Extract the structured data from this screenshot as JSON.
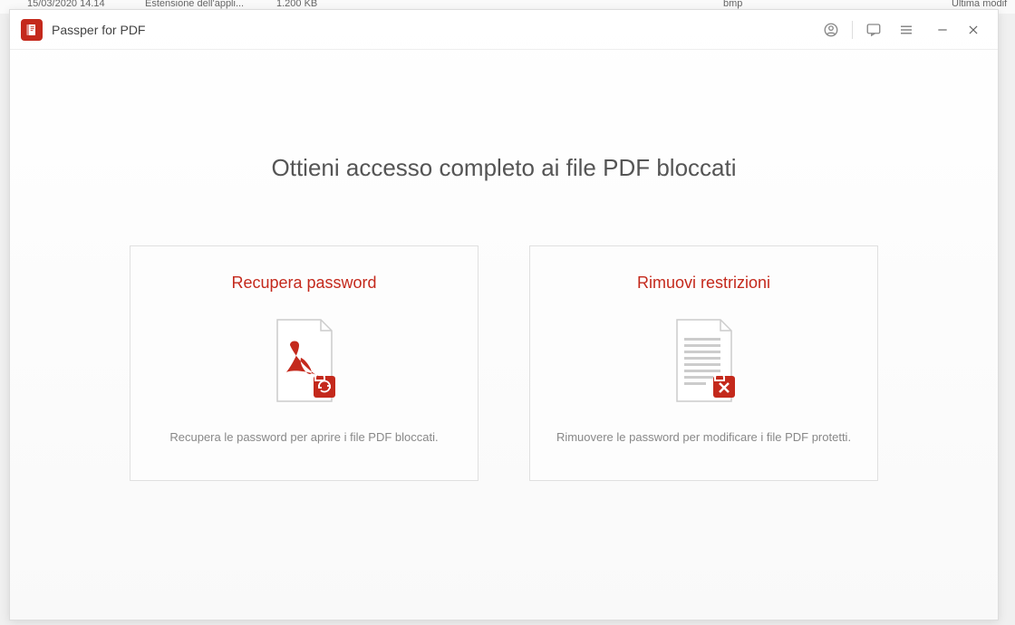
{
  "background": {
    "text1": "15/03/2020 14.14",
    "text2": "Estensione dell'appli...",
    "text3": "1.200 KB",
    "text4": "bmp",
    "text5": "Ultima modif"
  },
  "app": {
    "title": "Passper for PDF"
  },
  "main": {
    "headline": "Ottieni accesso completo ai file PDF bloccati",
    "cards": {
      "recover": {
        "title": "Recupera password",
        "desc": "Recupera le password per aprire i file PDF bloccati."
      },
      "remove": {
        "title": "Rimuovi restrizioni",
        "desc": "Rimuovere le password per modificare i file PDF protetti."
      }
    }
  }
}
